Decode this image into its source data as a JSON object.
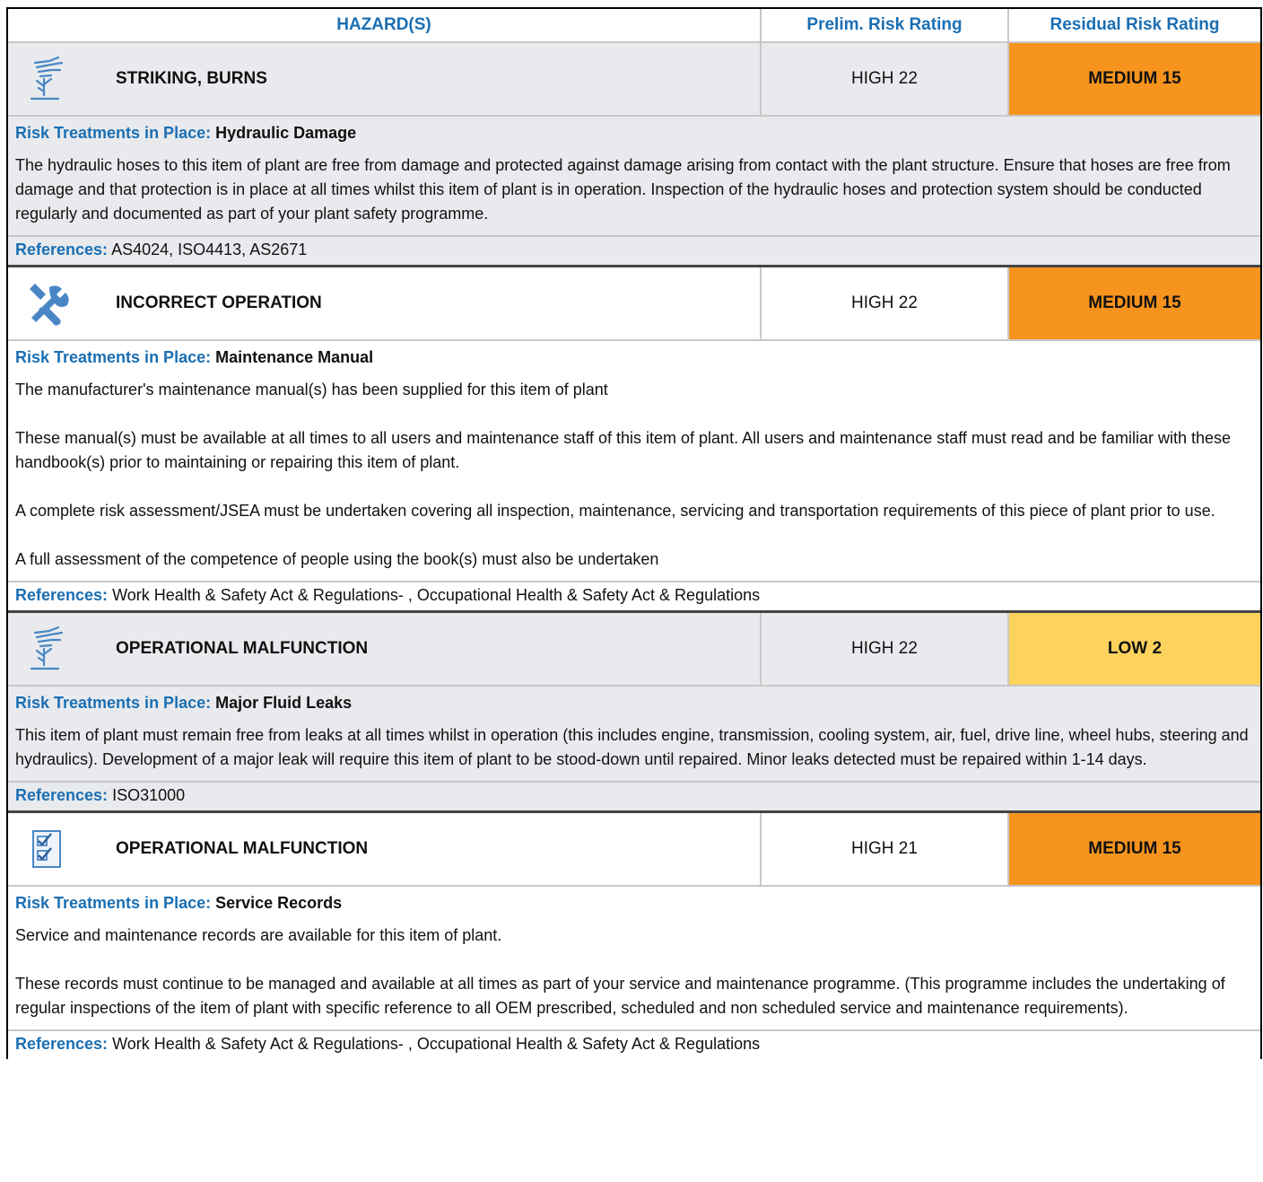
{
  "header": {
    "hazards": "HAZARD(S)",
    "prelim": "Prelim. Risk Rating",
    "residual": "Residual Risk Rating"
  },
  "colors": {
    "accent": "#1b6fb3",
    "medium": "#f7941d",
    "low": "#fdd35d"
  },
  "labels": {
    "treatments": "Risk Treatments in Place:",
    "references": "References:"
  },
  "hazards": [
    {
      "icon": "hazard-plant-icon",
      "name": "STRIKING, BURNS",
      "prelim": "HIGH 22",
      "residual": "MEDIUM 15",
      "treatment": "Hydraulic Damage",
      "paragraphs": [
        "The hydraulic hoses to this item of plant are free from damage and protected against damage arising from contact with the plant structure. Ensure that hoses are free from damage and that  protection is in place at all times whilst this item of plant is in operation. Inspection of the hydraulic hoses and  protection system should be conducted regularly and documented as part of your plant safety programme."
      ],
      "references": "AS4024, ISO4413, AS2671"
    },
    {
      "icon": "tools-icon",
      "name": "INCORRECT OPERATION",
      "prelim": "HIGH 22",
      "residual": "MEDIUM 15",
      "treatment": "Maintenance Manual",
      "paragraphs": [
        "The manufacturer's maintenance manual(s) has been supplied for this item of plant",
        "These manual(s) must be available at all times to all users and maintenance staff of this item of plant. All users and maintenance staff must read and be familiar with these handbook(s) prior to maintaining or repairing this item of plant.",
        "A complete risk assessment/JSEA must be undertaken covering all inspection, maintenance, servicing and transportation requirements of this piece of plant prior to use.",
        "A full assessment of the competence of people using the book(s) must also be undertaken"
      ],
      "references": "Work Health & Safety Act & Regulations- , Occupational Health & Safety Act & Regulations"
    },
    {
      "icon": "hazard-plant-icon",
      "name": "OPERATIONAL MALFUNCTION",
      "prelim": "HIGH 22",
      "residual": "LOW 2",
      "treatment": "Major Fluid Leaks",
      "paragraphs": [
        "This item of plant must remain free from leaks at all times whilst in operation (this includes engine, transmission, cooling system, air, fuel, drive line, wheel hubs, steering and hydraulics). Development of a major leak will require this item of plant to be stood-down until repaired. Minor leaks detected must be repaired within 1-14 days."
      ],
      "references": "ISO31000"
    },
    {
      "icon": "checklist-icon",
      "name": "OPERATIONAL MALFUNCTION",
      "prelim": "HIGH 21",
      "residual": "MEDIUM 15",
      "treatment": "Service Records",
      "paragraphs": [
        "Service and maintenance records are available for this item of plant.",
        "These records must continue to be managed and available at all times as part of your service and maintenance programme. (This programme includes the undertaking of regular inspections of the item of plant with specific reference to all OEM prescribed, scheduled and non scheduled service and maintenance requirements)."
      ],
      "references": "Work Health & Safety Act & Regulations- , Occupational Health & Safety Act & Regulations"
    }
  ]
}
